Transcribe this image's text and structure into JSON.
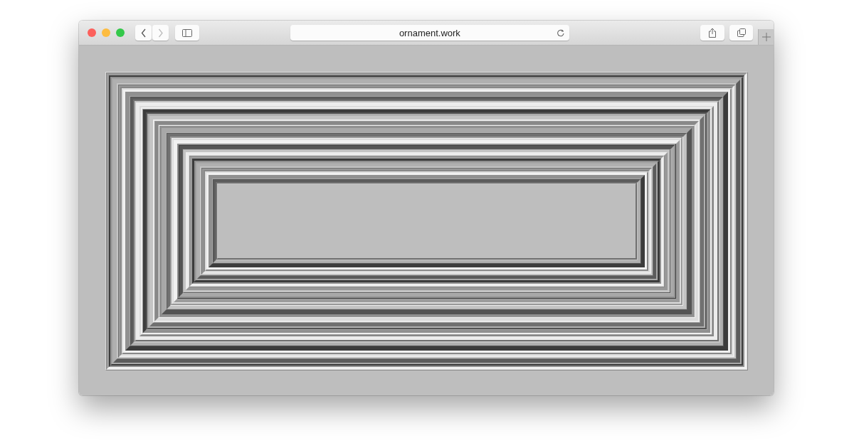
{
  "window": {
    "traffic_lights": [
      {
        "color": "#fc605c"
      },
      {
        "color": "#fdbc40"
      },
      {
        "color": "#34c84a"
      }
    ],
    "navigation": [
      {
        "kind": "back",
        "disabled": false
      },
      {
        "kind": "forward",
        "disabled": true
      }
    ],
    "address_bar": {
      "value": "ornament.work"
    }
  }
}
